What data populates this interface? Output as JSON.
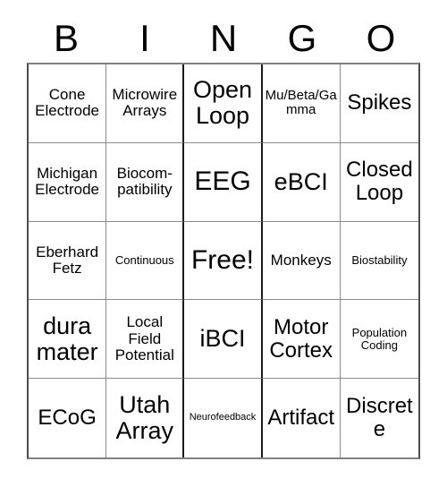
{
  "card": {
    "title": "BINGO Card",
    "header_letters": [
      "B",
      "I",
      "N",
      "G",
      "O"
    ],
    "free_space_label": "Free!",
    "grid_size": "5x5",
    "cells": [
      {
        "text": "Cone Electrode",
        "size": "sm"
      },
      {
        "text": "Microwire Arrays",
        "size": "sm"
      },
      {
        "text": "Open Loop",
        "size": "lg"
      },
      {
        "text": "Mu/Beta/Gamma",
        "size": "xs"
      },
      {
        "text": "Spikes",
        "size": "md"
      },
      {
        "text": "Michigan Electrode",
        "size": "sm"
      },
      {
        "text": "Biocom-patibility",
        "size": "sm"
      },
      {
        "text": "EEG",
        "size": "xl"
      },
      {
        "text": "eBCI",
        "size": "lg"
      },
      {
        "text": "Closed Loop",
        "size": "md"
      },
      {
        "text": "Eberhard Fetz",
        "size": "sm"
      },
      {
        "text": "Continuous",
        "size": "xxs"
      },
      {
        "text": "Free!",
        "size": "xl"
      },
      {
        "text": "Monkeys",
        "size": "sm"
      },
      {
        "text": "Biostability",
        "size": "xxs"
      },
      {
        "text": "dura mater",
        "size": "lg"
      },
      {
        "text": "Local Field Potential",
        "size": "sm"
      },
      {
        "text": "iBCI",
        "size": "lg"
      },
      {
        "text": "Motor Cortex",
        "size": "md"
      },
      {
        "text": "Population Coding",
        "size": "xxs"
      },
      {
        "text": "ECoG",
        "size": "md"
      },
      {
        "text": "Utah Array",
        "size": "lg"
      },
      {
        "text": "Neurofeedback",
        "size": "tiny"
      },
      {
        "text": "Artifact",
        "size": "md"
      },
      {
        "text": "Discrete",
        "size": "md"
      }
    ]
  },
  "colors": {
    "background": "#ffffff",
    "text": "#000000",
    "grid_line": "#8c8c8c",
    "outer_border": "#4d4d4d"
  }
}
